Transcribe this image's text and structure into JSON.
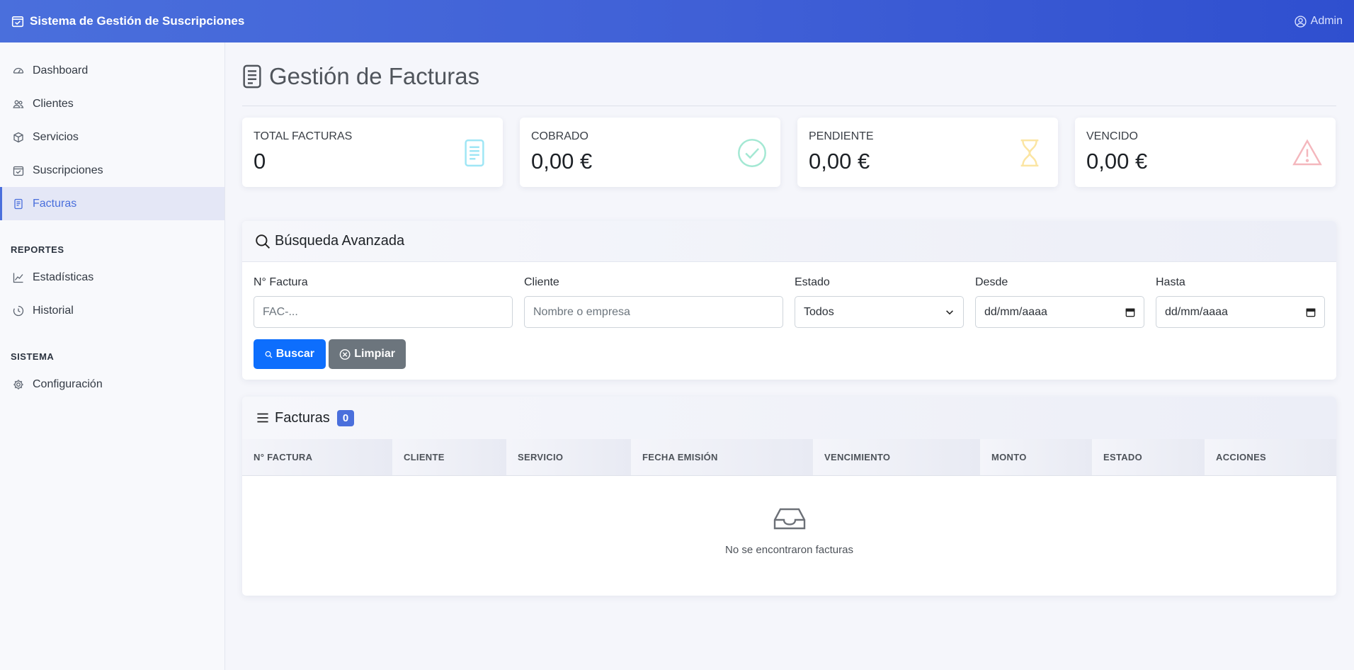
{
  "app": {
    "title": "Sistema de Gestión de Suscripciones",
    "user": "Admin"
  },
  "sidebar": {
    "items": [
      {
        "label": "Dashboard",
        "icon": "speedometer-icon"
      },
      {
        "label": "Clientes",
        "icon": "people-icon"
      },
      {
        "label": "Servicios",
        "icon": "box-icon"
      },
      {
        "label": "Suscripciones",
        "icon": "calendar-check-icon"
      },
      {
        "label": "Facturas",
        "icon": "file-text-icon",
        "active": true
      }
    ],
    "reportes_heading": "REPORTES",
    "reportes": [
      {
        "label": "Estadísticas",
        "icon": "graph-up-icon"
      },
      {
        "label": "Historial",
        "icon": "clock-history-icon"
      }
    ],
    "sistema_heading": "SISTEMA",
    "sistema": [
      {
        "label": "Configuración",
        "icon": "gear-icon"
      }
    ]
  },
  "page": {
    "title": "Gestión de Facturas"
  },
  "stats": [
    {
      "label": "TOTAL FACTURAS",
      "value": "0",
      "icon": "file-text-icon",
      "color": "#0dcaf0"
    },
    {
      "label": "COBRADO",
      "value": "0,00 €",
      "icon": "check-circle-icon",
      "color": "#20c997"
    },
    {
      "label": "PENDIENTE",
      "value": "0,00 €",
      "icon": "hourglass-icon",
      "color": "#ffc107"
    },
    {
      "label": "VENCIDO",
      "value": "0,00 €",
      "icon": "warning-icon",
      "color": "#dc3545"
    }
  ],
  "search": {
    "title": "Búsqueda Avanzada",
    "fields": {
      "factura": {
        "label": "N° Factura",
        "placeholder": "FAC-..."
      },
      "cliente": {
        "label": "Cliente",
        "placeholder": "Nombre o empresa"
      },
      "estado": {
        "label": "Estado",
        "value": "Todos"
      },
      "desde": {
        "label": "Desde",
        "value": "dd/mm/aaaa"
      },
      "hasta": {
        "label": "Hasta",
        "value": "dd/mm/aaaa"
      }
    },
    "buscar_label": "Buscar",
    "limpiar_label": "Limpiar"
  },
  "table": {
    "title": "Facturas",
    "count": "0",
    "columns": [
      "N° FACTURA",
      "CLIENTE",
      "SERVICIO",
      "FECHA EMISIÓN",
      "VENCIMIENTO",
      "MONTO",
      "ESTADO",
      "ACCIONES"
    ],
    "empty_message": "No se encontraron facturas"
  }
}
